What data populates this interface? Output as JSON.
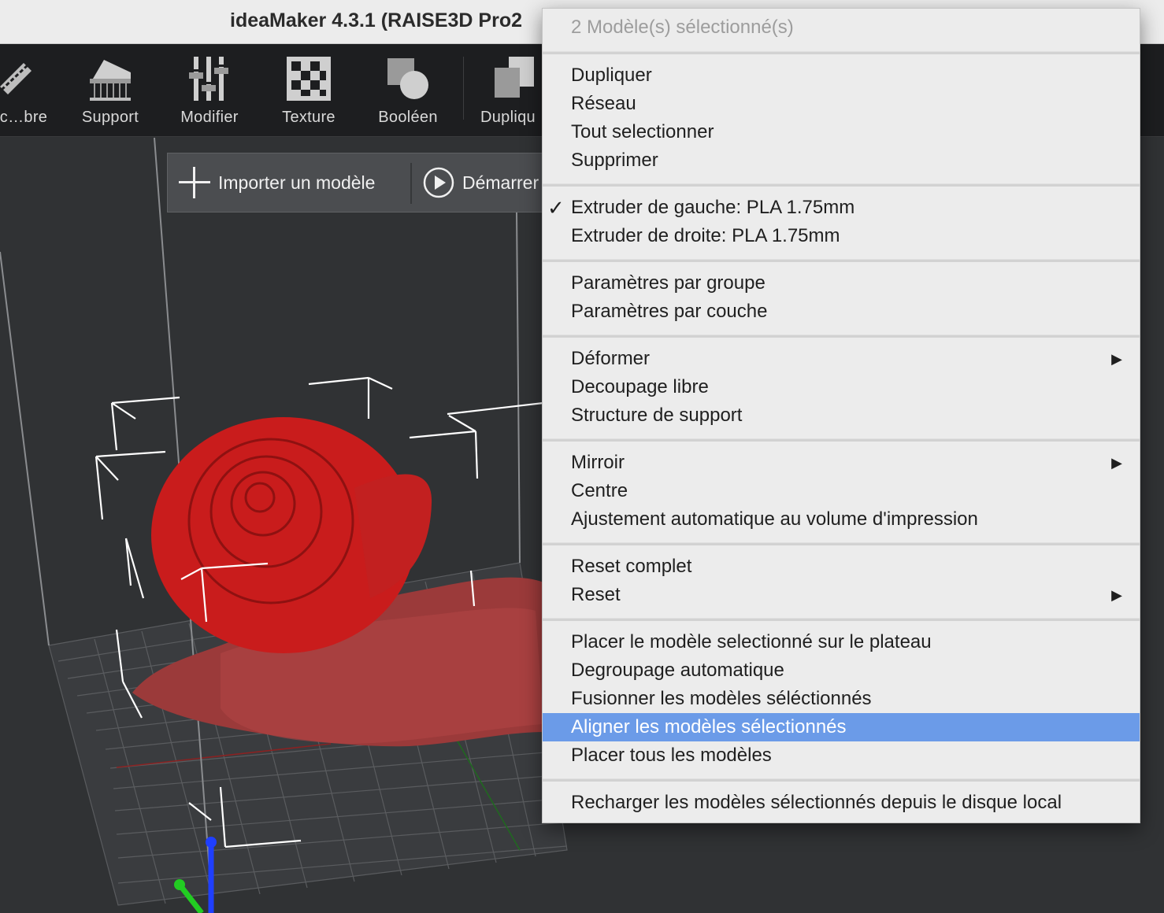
{
  "window": {
    "title": "ideaMaker 4.3.1 (RAISE3D Pro2"
  },
  "toolbar": {
    "items": [
      {
        "label": "c…bre",
        "icon": "cut-icon"
      },
      {
        "label": "Support",
        "icon": "support-icon"
      },
      {
        "label": "Modifier",
        "icon": "modifier-sliders-icon"
      },
      {
        "label": "Texture",
        "icon": "texture-checker-icon"
      },
      {
        "label": "Booléen",
        "icon": "boolean-shapes-icon"
      },
      {
        "label": "Dupliqu",
        "icon": "duplicate-icon"
      }
    ]
  },
  "actionbar": {
    "import_label": "Importer un modèle",
    "start_label": "Démarrer"
  },
  "context_menu": {
    "header": "2 Modèle(s) sélectionné(s)",
    "groups": [
      [
        {
          "label": "Dupliquer"
        },
        {
          "label": "Réseau"
        },
        {
          "label": "Tout selectionner"
        },
        {
          "label": "Supprimer"
        }
      ],
      [
        {
          "label": "Extruder de gauche: PLA 1.75mm",
          "checked": true
        },
        {
          "label": "Extruder de droite: PLA 1.75mm"
        }
      ],
      [
        {
          "label": "Paramètres par groupe"
        },
        {
          "label": "Paramètres par couche"
        }
      ],
      [
        {
          "label": "Déformer",
          "submenu": true
        },
        {
          "label": "Decoupage libre"
        },
        {
          "label": "Structure de support"
        }
      ],
      [
        {
          "label": "Mirroir",
          "submenu": true
        },
        {
          "label": "Centre"
        },
        {
          "label": "Ajustement automatique au volume d'impression"
        }
      ],
      [
        {
          "label": "Reset complet"
        },
        {
          "label": "Reset",
          "submenu": true
        }
      ],
      [
        {
          "label": "Placer le modèle selectionné sur le plateau"
        },
        {
          "label": "Degroupage automatique"
        },
        {
          "label": "Fusionner les modèles séléctionnés"
        },
        {
          "label": "Aligner les modèles sélectionnés",
          "highlighted": true
        },
        {
          "label": "Placer tous les modèles"
        }
      ],
      [
        {
          "label": "Recharger les modèles sélectionnés depuis le disque local"
        }
      ]
    ]
  },
  "colors": {
    "highlight": "#6b9be8",
    "model_red": "#c91c1c",
    "model_body": "#9b3a3a",
    "axis_z": "#1f3fff",
    "axis_y": "#22cc22",
    "axis_x": "#cc2222"
  }
}
